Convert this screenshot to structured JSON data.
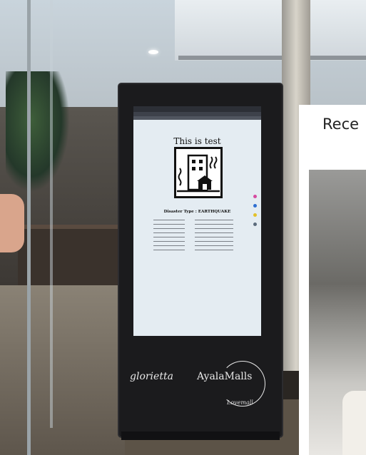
{
  "screen_page": {
    "heading": "This is test",
    "disaster_label": "Disaster Type : EARTHQUAKE",
    "page_icon": "building-icon",
    "side_dot_colors": [
      "#d64aa0",
      "#2f6fd1",
      "#e3c12a",
      "#5b6b7c"
    ]
  },
  "branding": {
    "glorietta": "glorietta",
    "ayala": "AyalaMalls",
    "tagline": "Lovemall"
  },
  "inset": {
    "title_fragment": "Rece"
  },
  "colors": {
    "kiosk_body": "#1b1b1d",
    "screen_background": "#e4ecf2",
    "inset_background": "#ffffff"
  }
}
